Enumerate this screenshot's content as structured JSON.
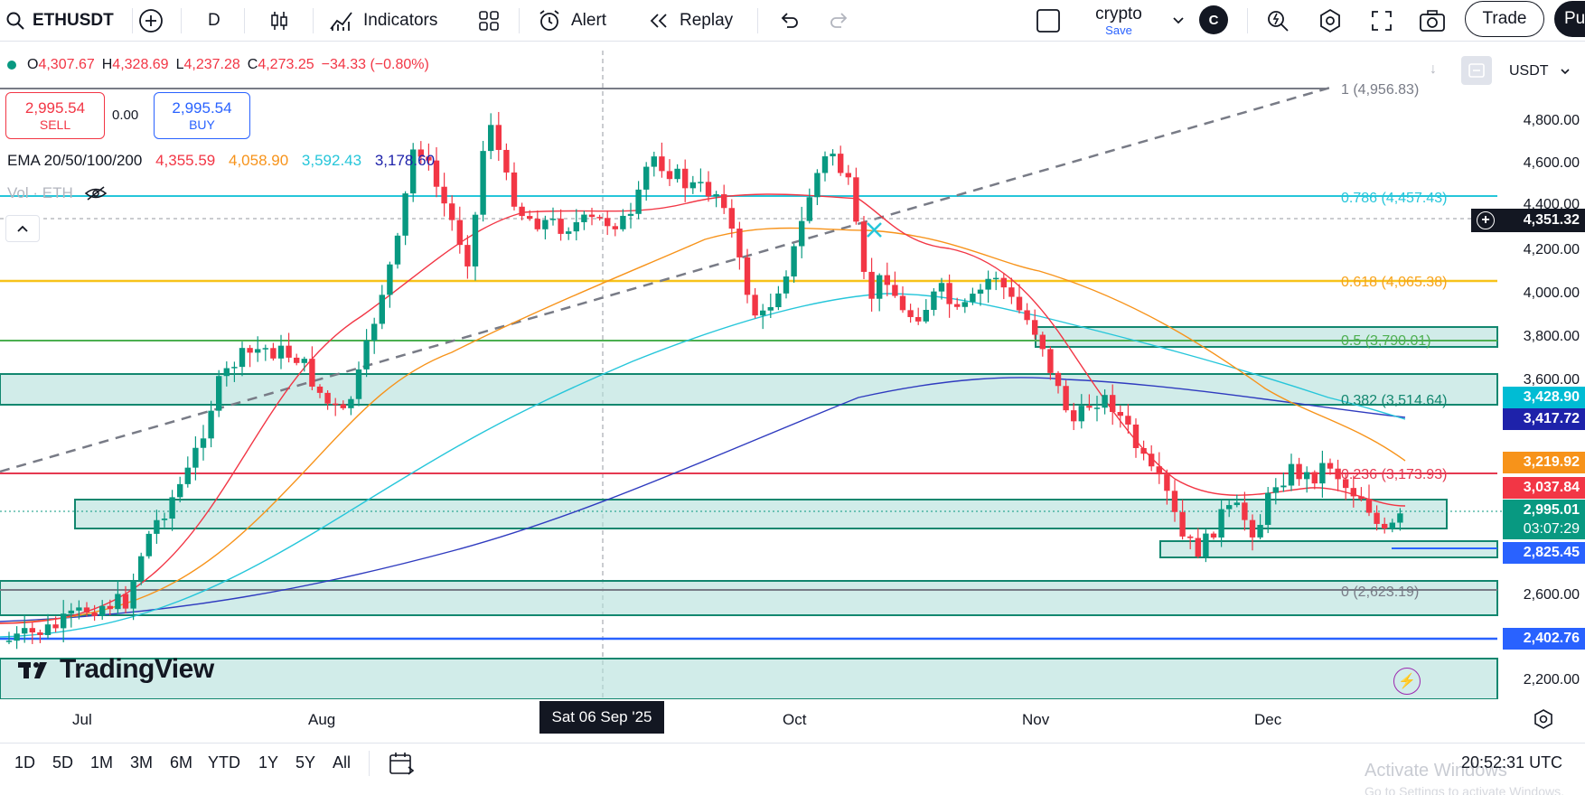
{
  "toolbar": {
    "symbol": "ETHUSDT",
    "interval": "D",
    "indicators_label": "Indicators",
    "alert_label": "Alert",
    "replay_label": "Replay",
    "layout_name": "crypto",
    "save_label": "Save",
    "avatar_letter": "C",
    "trade_label": "Trade",
    "publish_label": "Pu"
  },
  "ohlc": {
    "o_label": "O",
    "o": "4,307.67",
    "h_label": "H",
    "h": "4,328.69",
    "l_label": "L",
    "l": "4,237.28",
    "c_label": "C",
    "c": "4,273.25",
    "change": "−34.33 (−0.80%)"
  },
  "trade": {
    "sell_price": "2,995.54",
    "sell_label": "SELL",
    "spread": "0.00",
    "buy_price": "2,995.54",
    "buy_label": "BUY"
  },
  "ema": {
    "label": "EMA 20/50/100/200",
    "values": [
      "4,355.59",
      "4,058.90",
      "3,592.43",
      "3,178.60"
    ],
    "colors": [
      "#f23645",
      "#f7931a",
      "#26c6da",
      "#1e22aa"
    ]
  },
  "volume": {
    "label": "Vol · ETH"
  },
  "currency": "USDT",
  "price_axis": [
    "4,800.00",
    "4,600.00",
    "4,400.00",
    "4,200.00",
    "4,000.00",
    "3,800.00",
    "3,600.00",
    "2,600.00",
    "2,200.00"
  ],
  "fib_labels": [
    "1 (4,956.83)",
    "0.786 (4,457.43)",
    "0.618 (4,065.38)",
    "0.5 (3,790.01)",
    "0.382 (3,514.64)",
    "0.236 (3,173.93)",
    "0 (2,623.19)"
  ],
  "price_tags": {
    "crosshair": "4,351.32",
    "t1": "3,428.90",
    "t2": "3,417.72",
    "t3": "3,219.92",
    "t4": "3,037.84",
    "last": "2,995.01",
    "countdown": "03:07:29",
    "t5": "2,825.45",
    "t6": "2,402.76"
  },
  "time_axis": [
    "Jul",
    "Aug",
    "Oct",
    "Nov",
    "Dec"
  ],
  "time_crosshair": "Sat 06 Sep '25",
  "ranges": [
    "1D",
    "5D",
    "1M",
    "3M",
    "6M",
    "YTD",
    "1Y",
    "5Y",
    "All"
  ],
  "clock": "20:52:31 UTC",
  "watermark": {
    "line1": "Activate Windows",
    "line2": "Go to Settings to activate Windows."
  },
  "logo_text": "TradingView",
  "colors": {
    "up": "#089981",
    "down": "#f23645",
    "accent": "#2962ff",
    "zone": "#b2dfdb"
  }
}
